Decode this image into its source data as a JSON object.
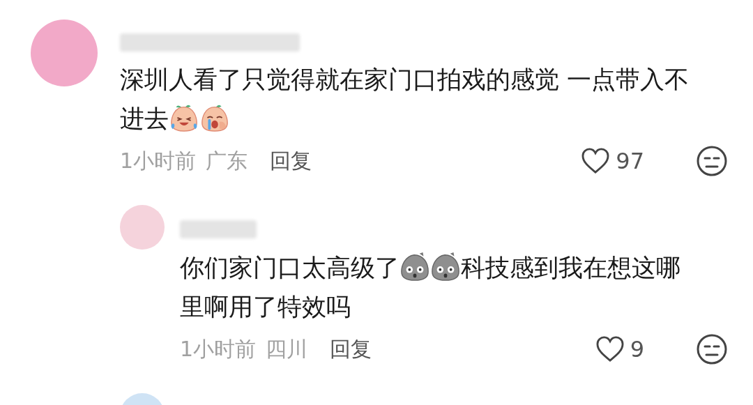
{
  "comments": [
    {
      "body": [
        {
          "kind": "text",
          "text": "深圳人看了只觉得就在家门口拍戏的感觉 一点带入不进去"
        },
        {
          "kind": "laugh-cry"
        },
        {
          "kind": "sob"
        }
      ],
      "time": "1小时前",
      "region": "广东",
      "reply_label": "回复",
      "likes": "97",
      "replies": [
        {
          "body": [
            {
              "kind": "text",
              "text": "你们家门口太高级了"
            },
            {
              "kind": "shocked"
            },
            {
              "kind": "shocked"
            },
            {
              "kind": "text",
              "text": "科技感到我在想这哪里啊用了特效吗"
            }
          ],
          "time": "1小时前",
          "region": "四川",
          "reply_label": "回复",
          "likes": "9"
        }
      ]
    }
  ]
}
